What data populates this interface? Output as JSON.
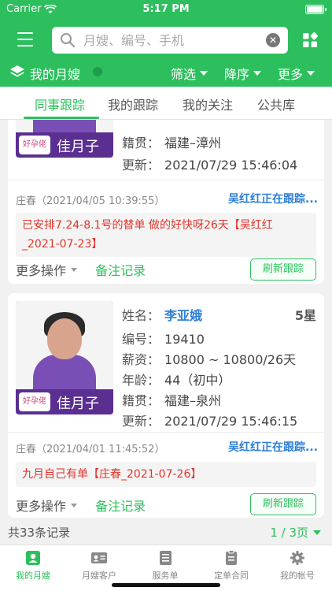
{
  "status_bar": {
    "carrier": "Carrier",
    "time": "5:17 PM"
  },
  "search": {
    "placeholder": "月嫂、编号、手机"
  },
  "subbar": {
    "title": "我的月嫂",
    "filter": "筛选",
    "sort": "降序",
    "more": "更多"
  },
  "tabs": [
    "同事跟踪",
    "我的跟踪",
    "我的关注",
    "公共库"
  ],
  "active_tab": 0,
  "cards": [
    {
      "photo_brand": "佳月子",
      "photo_logo": "好孕佬",
      "rows": [
        {
          "key": "籍贯：",
          "value": "福建–漳州"
        },
        {
          "key": "更新：",
          "value": "2021/07/29 15:46:04"
        }
      ],
      "creator": "庄春（2021/04/05 10:39:55）",
      "tracking": "吴红红正在跟踪...",
      "note": "已安排7.24-8.1号的替单 做的好快呀26天【吴红红_2021-07-23】",
      "more_ops": "更多操作",
      "note_record": "备注记录",
      "refresh": "刷新跟踪"
    },
    {
      "photo_brand": "佳月子",
      "photo_logo": "好孕佬",
      "name_key": "姓名：",
      "name": "李亚娥",
      "stars": "5星",
      "rows": [
        {
          "key": "编号：",
          "value": "19410"
        },
        {
          "key": "薪资：",
          "value": "10800 ~ 10800/26天"
        },
        {
          "key": "年龄：",
          "value": "44（初中）"
        },
        {
          "key": "籍贯：",
          "value": "福建–泉州"
        },
        {
          "key": "更新：",
          "value": "2021/07/29 15:46:15"
        }
      ],
      "creator": "庄春（2021/04/01 11:45:52）",
      "tracking": "吴红红正在跟踪...",
      "note": "九月自己有单【庄春_2021-07-26】",
      "more_ops": "更多操作",
      "note_record": "备注记录",
      "refresh": "刷新跟踪"
    }
  ],
  "pager": {
    "count": "共33条记录",
    "page": "1 / 3页"
  },
  "tabbar": [
    "我的月嫂",
    "月嫂客户",
    "服务单",
    "定单合同",
    "我的帐号"
  ],
  "colors": {
    "brand_green": "#2dbf5d",
    "link_blue": "#2d7fd6",
    "note_red": "#e0352b"
  }
}
